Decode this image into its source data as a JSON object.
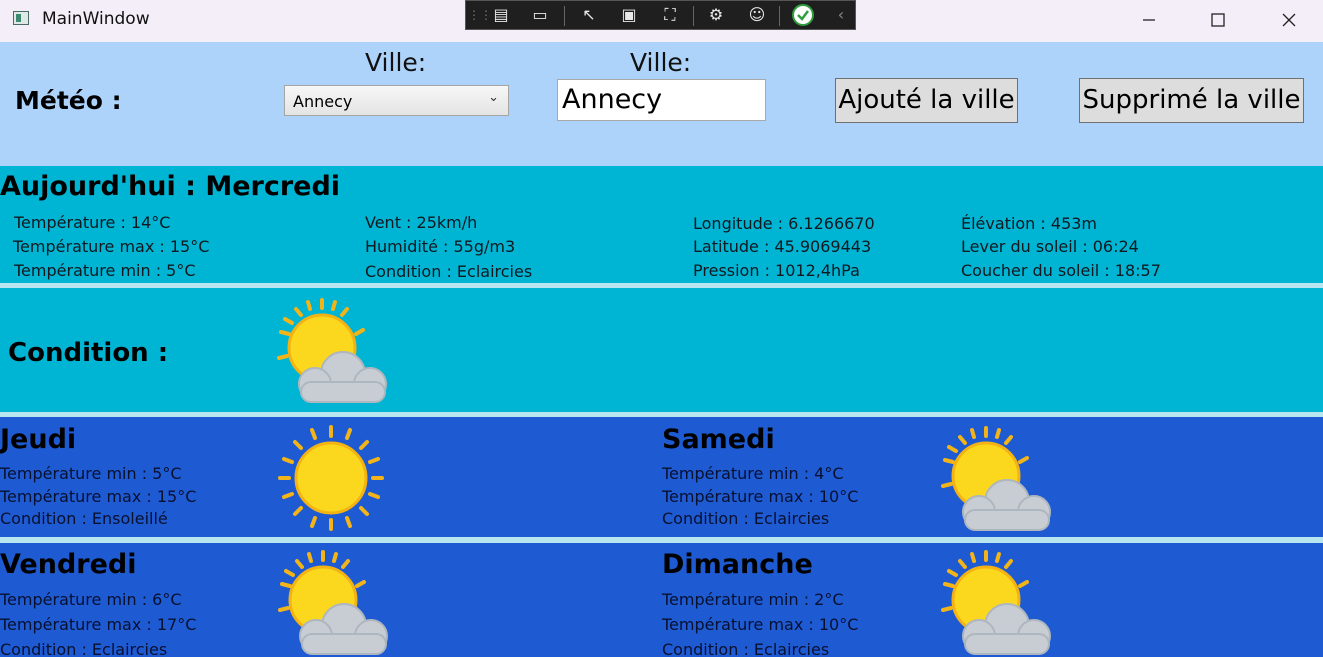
{
  "window": {
    "title": "MainWindow"
  },
  "header": {
    "meteo_label": "Météo :",
    "ville_label_1": "Ville:",
    "ville_label_2": "Ville:",
    "city_select_value": "Annecy",
    "city_input_value": "Annecy",
    "add_button": "Ajouté la ville",
    "remove_button": "Supprimé la ville"
  },
  "today": {
    "title": "Aujourd'hui : Mercredi",
    "temp": "Température : 14°C",
    "temp_max": "Température max : 15°C",
    "temp_min": "Température min : 5°C",
    "wind": "Vent : 25km/h",
    "humidity": "Humidité : 55g/m3",
    "condition": "Condition : Eclaircies",
    "longitude": "Longitude : 6.1266670",
    "latitude": "Latitude : 45.9069443",
    "pressure": "Pression : 1012,4hPa",
    "elevation": "Élévation : 453m",
    "sunrise": "Lever du soleil : 06:24",
    "sunset": "Coucher du soleil : 18:57",
    "condition_label": "Condition :",
    "condition_icon": "sun-cloud-icon"
  },
  "forecast": [
    {
      "day": "Jeudi",
      "min": "Température min : 5°C",
      "max": "Température max : 15°C",
      "cond": "Condition : Ensoleillé",
      "icon": "sun-icon"
    },
    {
      "day": "Samedi",
      "min": "Température min : 4°C",
      "max": "Température max : 10°C",
      "cond": "Condition : Eclaircies",
      "icon": "sun-cloud-icon"
    },
    {
      "day": "Vendredi",
      "min": "Température min : 6°C",
      "max": "Température max : 17°C",
      "cond": "Condition : Eclaircies",
      "icon": "sun-cloud-icon"
    },
    {
      "day": "Dimanche",
      "min": "Température min : 2°C",
      "max": "Température max : 10°C",
      "cond": "Condition : Eclaircies",
      "icon": "sun-cloud-icon"
    }
  ],
  "colors": {
    "header": "#add3fb",
    "today": "#00b5d3",
    "forecast": "#1e5bd3"
  }
}
